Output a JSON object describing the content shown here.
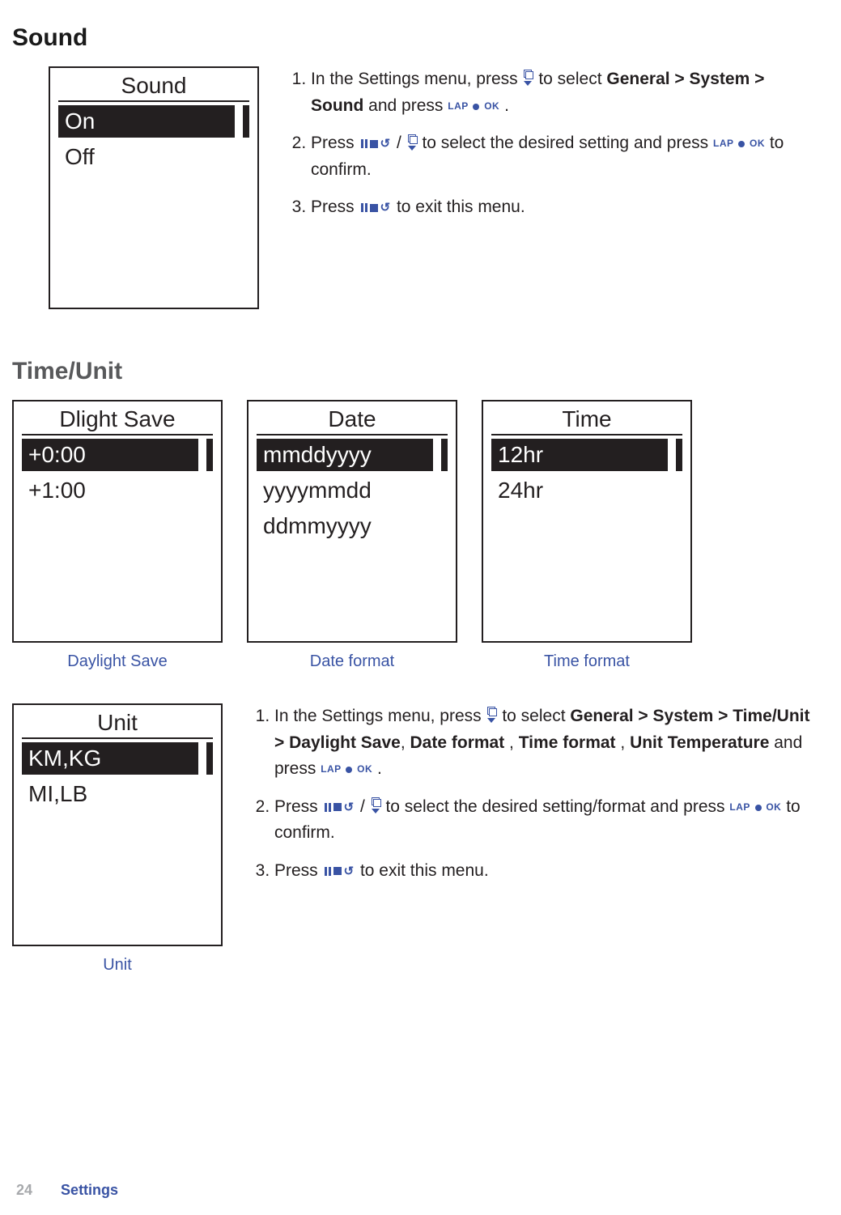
{
  "section_sound": {
    "heading": "Sound",
    "screen": {
      "title": "Sound",
      "items": [
        "On",
        "Off"
      ],
      "selected_index": 0
    },
    "instructions": {
      "step1_a": "In the Settings menu, press ",
      "step1_b": " to select ",
      "step1_path": [
        "General",
        "System",
        "Sound"
      ],
      "step1_c": " and press ",
      "step1_d": " .",
      "step2_a": "Press ",
      "step2_b": " / ",
      "step2_c": " to select the desired setting and press ",
      "step2_d": " to confirm.",
      "step3_a": "Press ",
      "step3_b": " to exit this menu."
    }
  },
  "section_timeunit": {
    "heading": "Time/Unit",
    "screens": [
      {
        "title": "Dlight Save",
        "items": [
          "+0:00",
          "+1:00"
        ],
        "selected_index": 0,
        "caption": "Daylight Save"
      },
      {
        "title": "Date",
        "items": [
          "mmddyyyy",
          "yyyymmdd",
          "ddmmyyyy"
        ],
        "selected_index": 0,
        "caption": "Date format"
      },
      {
        "title": "Time",
        "items": [
          "12hr",
          "24hr"
        ],
        "selected_index": 0,
        "caption": "Time format"
      },
      {
        "title": "Unit",
        "items": [
          "KM,KG",
          "MI,LB"
        ],
        "selected_index": 0,
        "caption": "Unit"
      }
    ],
    "instructions": {
      "step1_a": "In the Settings menu, press ",
      "step1_b": " to select ",
      "step1_path": [
        "General",
        "System",
        "Time/Unit",
        "Daylight Save"
      ],
      "step1_sep": ", ",
      "step1_extra": [
        "Date format",
        "Time format",
        "Unit",
        "Temperature"
      ],
      "step1_c": " and press ",
      "step1_d": " .",
      "step2_a": "Press ",
      "step2_b": " / ",
      "step2_c": " to select the desired setting/format and press ",
      "step2_d": " to confirm.",
      "step3_a": "Press ",
      "step3_b": " to exit this menu."
    }
  },
  "icons": {
    "lapok_lap": "LAP",
    "lapok_ok": "OK"
  },
  "footer": {
    "page": "24",
    "label": "Settings"
  },
  "path_separator": " > "
}
